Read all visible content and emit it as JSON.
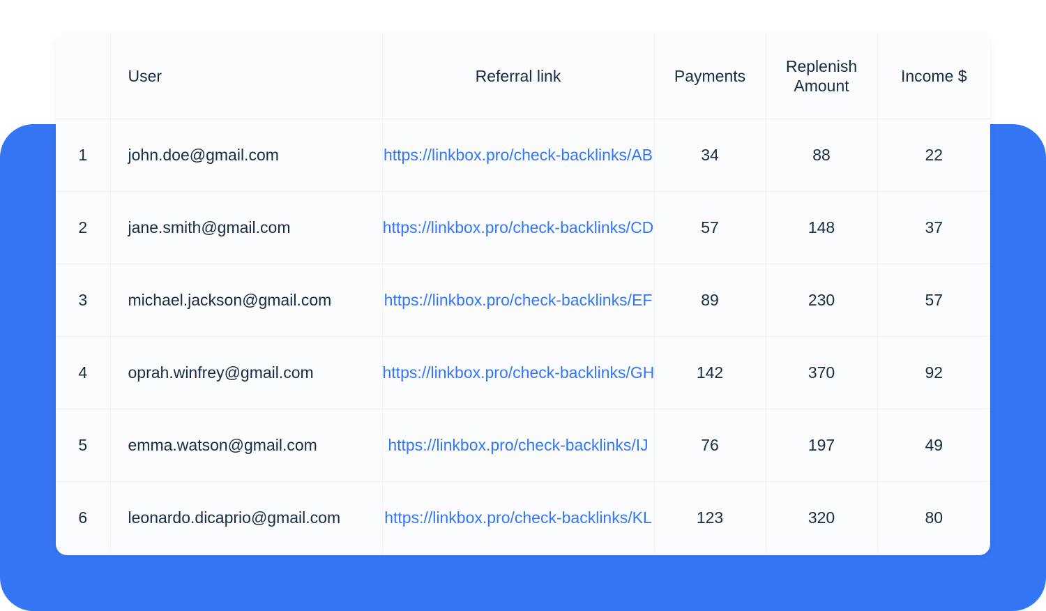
{
  "colors": {
    "accent": "#3476f3",
    "background": "#ffffff",
    "card": "#fbfcfd",
    "text": "#1b2a44",
    "link": "#3476f3"
  },
  "table": {
    "columns": {
      "index": "",
      "user": "User",
      "referral_link": "Referral link",
      "payments": "Payments",
      "replenish_amount": "Replenish Amount",
      "income": "Income $"
    },
    "rows": [
      {
        "index": "1",
        "user": "john.doe@gmail.com",
        "referral_link": "https://linkbox.pro/check-backlinks/AB",
        "payments": "34",
        "replenish_amount": "88",
        "income": "22"
      },
      {
        "index": "2",
        "user": "jane.smith@gmail.com",
        "referral_link": "https://linkbox.pro/check-backlinks/CD",
        "payments": "57",
        "replenish_amount": "148",
        "income": "37"
      },
      {
        "index": "3",
        "user": "michael.jackson@gmail.com",
        "referral_link": "https://linkbox.pro/check-backlinks/EF",
        "payments": "89",
        "replenish_amount": "230",
        "income": "57"
      },
      {
        "index": "4",
        "user": "oprah.winfrey@gmail.com",
        "referral_link": "https://linkbox.pro/check-backlinks/GH",
        "payments": "142",
        "replenish_amount": "370",
        "income": "92"
      },
      {
        "index": "5",
        "user": "emma.watson@gmail.com",
        "referral_link": "https://linkbox.pro/check-backlinks/IJ",
        "payments": "76",
        "replenish_amount": "197",
        "income": "49"
      },
      {
        "index": "6",
        "user": "leonardo.dicaprio@gmail.com",
        "referral_link": "https://linkbox.pro/check-backlinks/KL",
        "payments": "123",
        "replenish_amount": "320",
        "income": "80"
      }
    ]
  }
}
